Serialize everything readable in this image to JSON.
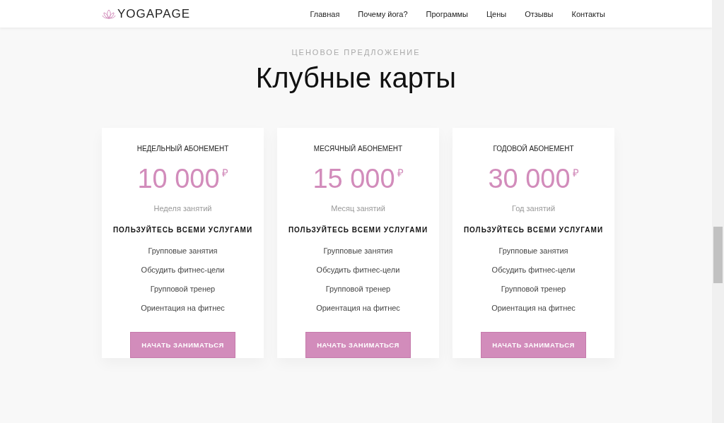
{
  "header": {
    "logo": "YOGAPAGE",
    "nav": [
      {
        "label": "Главная"
      },
      {
        "label": "Почему йога?"
      },
      {
        "label": "Программы"
      },
      {
        "label": "Цены"
      },
      {
        "label": "Отзывы"
      },
      {
        "label": "Контакты"
      }
    ]
  },
  "section": {
    "eyebrow": "ЦЕНОВОЕ ПРЕДЛОЖЕНИЕ",
    "title": "Клубные карты"
  },
  "plans": [
    {
      "name": "НЕДЕЛЬНЫЙ АБОНЕМЕНТ",
      "price": "10 000",
      "currency": "₽",
      "period": "Неделя занятий",
      "heading": "ПОЛЬЗУЙТЕСЬ ВСЕМИ УСЛУГАМИ",
      "features": [
        "Групповые занятия",
        "Обсудить фитнес-цели",
        "Групповой тренер",
        "Ориентация на фитнес"
      ],
      "button": "НАЧАТЬ ЗАНИМАТЬСЯ"
    },
    {
      "name": "МЕСЯЧНЫЙ АБОНЕМЕНТ",
      "price": "15 000",
      "currency": "₽",
      "period": "Месяц занятий",
      "heading": "ПОЛЬЗУЙТЕСЬ ВСЕМИ УСЛУГАМИ",
      "features": [
        "Групповые занятия",
        "Обсудить фитнес-цели",
        "Групповой тренер",
        "Ориентация на фитнес"
      ],
      "button": "НАЧАТЬ ЗАНИМАТЬСЯ"
    },
    {
      "name": "ГОДОВОЙ АБОНЕМЕНТ",
      "price": "30 000",
      "currency": "₽",
      "period": "Год занятий",
      "heading": "ПОЛЬЗУЙТЕСЬ ВСЕМИ УСЛУГАМИ",
      "features": [
        "Групповые занятия",
        "Обсудить фитнес-цели",
        "Групповой тренер",
        "Ориентация на фитнес"
      ],
      "button": "НАЧАТЬ ЗАНИМАТЬСЯ"
    }
  ]
}
